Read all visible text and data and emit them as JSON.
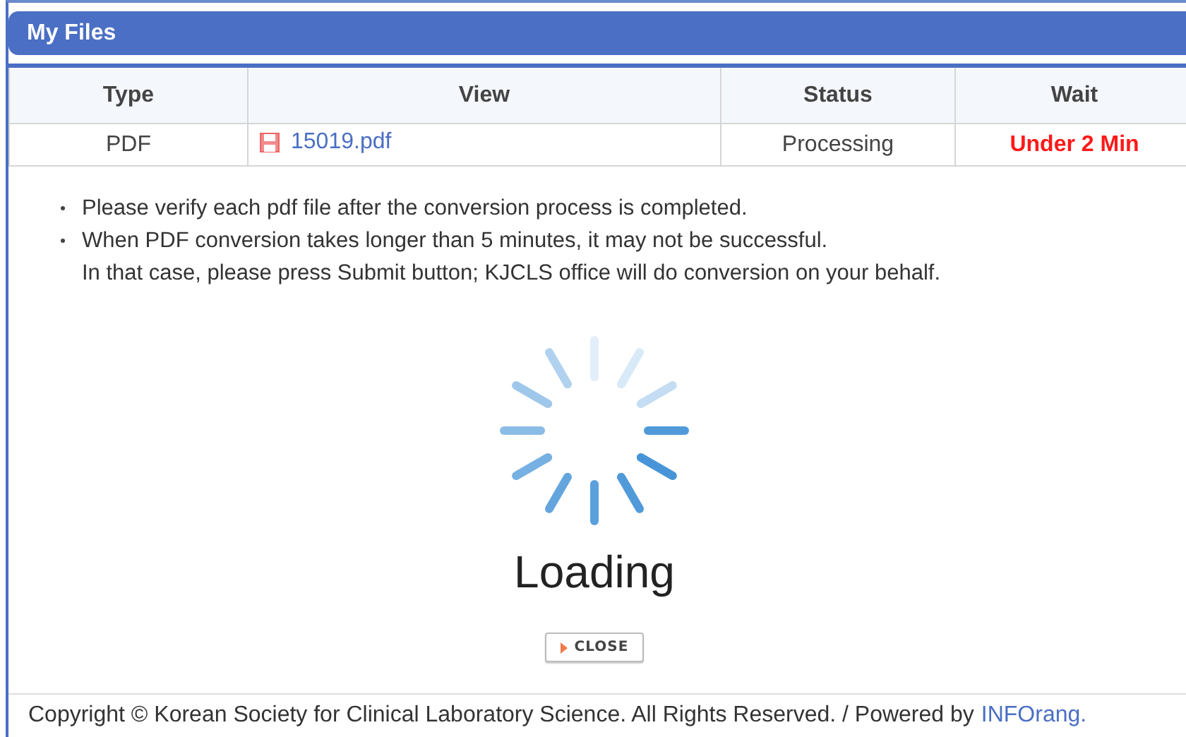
{
  "panel": {
    "title": "My Files"
  },
  "table": {
    "columns": [
      "Type",
      "View",
      "Status",
      "Wait"
    ],
    "rows": [
      {
        "type": "PDF",
        "file": "15019.pdf",
        "status": "Processing",
        "wait": "Under 2 Min"
      }
    ]
  },
  "notes": [
    {
      "lines": [
        "Please verify each pdf file after the conversion process is completed."
      ]
    },
    {
      "lines": [
        "When PDF conversion takes longer than 5 minutes, it may not be successful.",
        "In that case, please press Submit button; KJCLS office will do conversion on your behalf."
      ]
    }
  ],
  "loading": {
    "label": "Loading"
  },
  "close_button": {
    "label": "CLOSE"
  },
  "footer": {
    "text": "Copyright © Korean Society for Clinical Laboratory Science. All Rights Reserved. / Powered by",
    "link": "INFOrang."
  }
}
